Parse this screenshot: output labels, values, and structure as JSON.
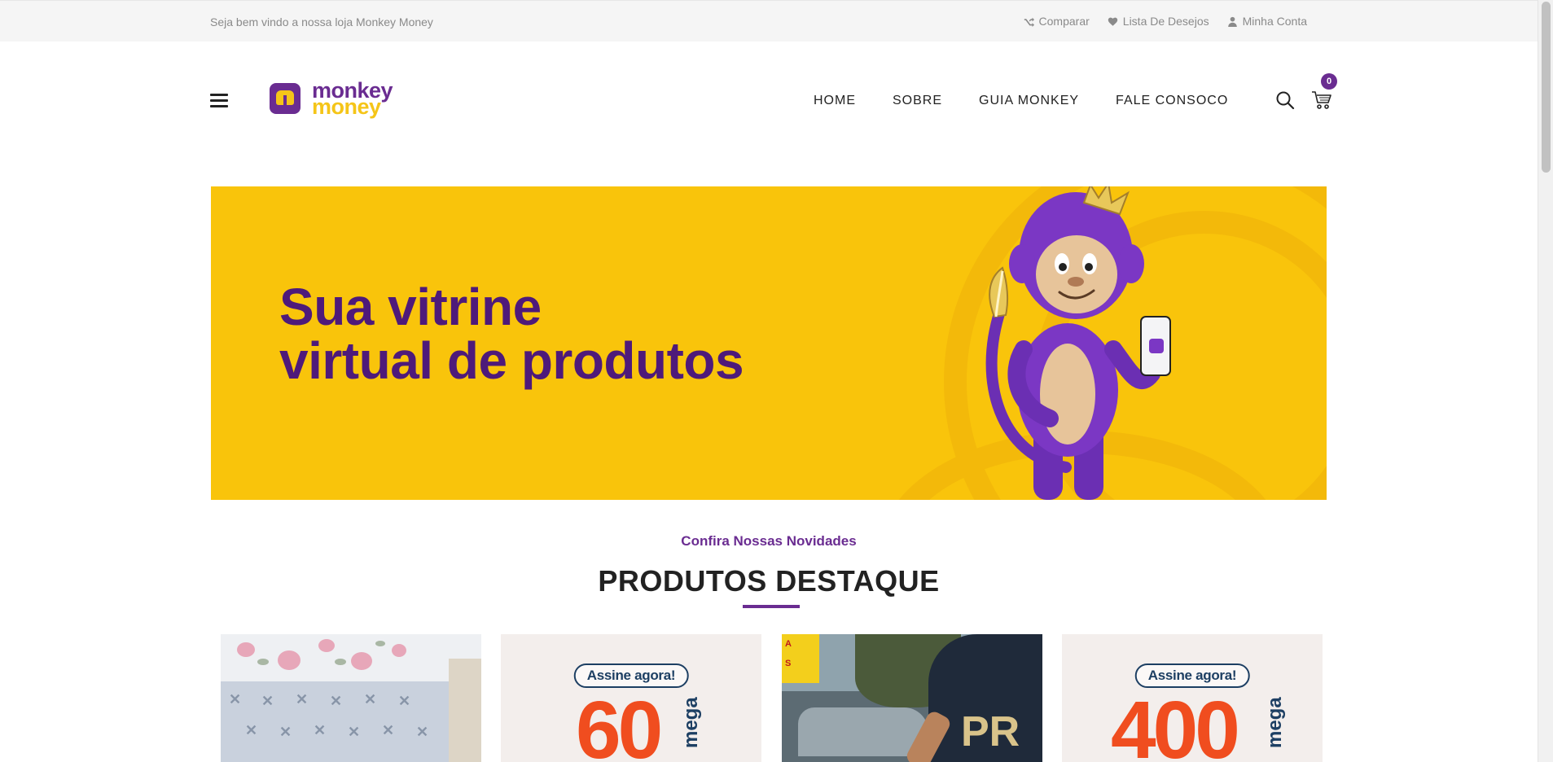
{
  "topbar": {
    "welcome": "Seja bem vindo a nossa loja Monkey Money",
    "compare": "Comparar",
    "wishlist": "Lista De Desejos",
    "account": "Minha Conta"
  },
  "header": {
    "logo_line1": "monkey",
    "logo_line2": "money",
    "nav": [
      "HOME",
      "SOBRE",
      "GUIA MONKEY",
      "FALE CONSOCO"
    ],
    "cart_count": "0"
  },
  "banner": {
    "line1": "Sua vitrine",
    "line2": "virtual de produtos"
  },
  "section": {
    "subtitle": "Confira Nossas Novidades",
    "title": "PRODUTOS DESTAQUE"
  },
  "products": [
    {
      "kind": "photo",
      "icon": "bedding-image"
    },
    {
      "kind": "promo",
      "badge": "Assine agora!",
      "value": "60",
      "unit": "mega"
    },
    {
      "kind": "photo",
      "icon": "police-image",
      "sign": "A",
      "sign2": "S",
      "patch": "PR"
    },
    {
      "kind": "promo",
      "badge": "Assine agora!",
      "value": "400",
      "unit": "mega"
    }
  ],
  "colors": {
    "brand_purple": "#6a2c91",
    "brand_yellow": "#f9c40b",
    "promo_orange": "#f04d1f",
    "promo_navy": "#1d3f63"
  }
}
